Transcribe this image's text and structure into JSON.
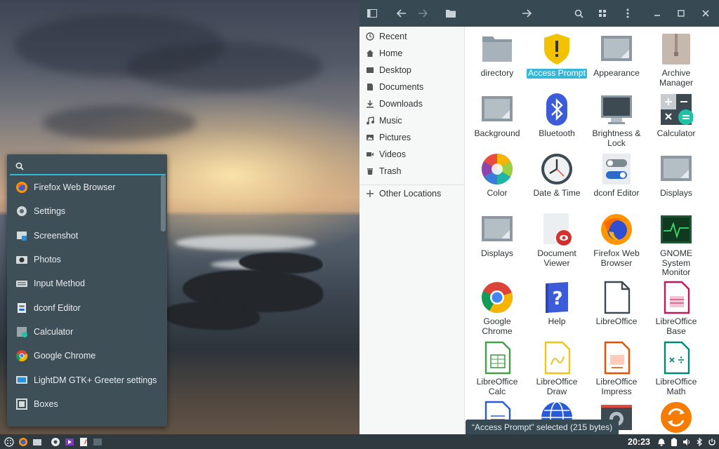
{
  "launcher": {
    "search_placeholder": "",
    "items": [
      {
        "label": "Firefox Web Browser",
        "icon": "firefox-icon"
      },
      {
        "label": "Settings",
        "icon": "settings-icon"
      },
      {
        "label": "Screenshot",
        "icon": "screenshot-icon"
      },
      {
        "label": "Photos",
        "icon": "photos-icon"
      },
      {
        "label": "Input Method",
        "icon": "keyboard-icon"
      },
      {
        "label": "dconf Editor",
        "icon": "dconf-icon"
      },
      {
        "label": "Calculator",
        "icon": "calculator-icon"
      },
      {
        "label": "Google Chrome",
        "icon": "chrome-icon"
      },
      {
        "label": "LightDM GTK+ Greeter settings",
        "icon": "lightdm-icon"
      },
      {
        "label": "Boxes",
        "icon": "boxes-icon"
      }
    ]
  },
  "taskbar": {
    "clock": "20:23"
  },
  "file_manager": {
    "sidebar": [
      {
        "label": "Recent",
        "icon": "clock-icon"
      },
      {
        "label": "Home",
        "icon": "home-icon"
      },
      {
        "label": "Desktop",
        "icon": "desktop-icon"
      },
      {
        "label": "Documents",
        "icon": "documents-icon"
      },
      {
        "label": "Downloads",
        "icon": "downloads-icon"
      },
      {
        "label": "Music",
        "icon": "music-icon"
      },
      {
        "label": "Pictures",
        "icon": "pictures-icon"
      },
      {
        "label": "Videos",
        "icon": "videos-icon"
      },
      {
        "label": "Trash",
        "icon": "trash-icon"
      }
    ],
    "other_locations": "Other Locations",
    "grid": [
      {
        "label": "directory",
        "icon": "folder-icon"
      },
      {
        "label": "Access Prompt",
        "icon": "warning-shield-icon",
        "selected": true
      },
      {
        "label": "Appearance",
        "icon": "appearance-icon"
      },
      {
        "label": "Archive Manager",
        "icon": "archive-icon"
      },
      {
        "label": "Background",
        "icon": "background-icon"
      },
      {
        "label": "Bluetooth",
        "icon": "bluetooth-icon"
      },
      {
        "label": "Brightness & Lock",
        "icon": "monitor-icon"
      },
      {
        "label": "Calculator",
        "icon": "calculator-icon"
      },
      {
        "label": "Color",
        "icon": "color-wheel-icon"
      },
      {
        "label": "Date & Time",
        "icon": "clock-icon"
      },
      {
        "label": "dconf Editor",
        "icon": "toggles-icon"
      },
      {
        "label": "Displays",
        "icon": "display-icon"
      },
      {
        "label": "Displays",
        "icon": "display-icon"
      },
      {
        "label": "Document Viewer",
        "icon": "document-viewer-icon"
      },
      {
        "label": "Firefox Web Browser",
        "icon": "firefox-icon"
      },
      {
        "label": "GNOME System Monitor",
        "icon": "system-monitor-icon"
      },
      {
        "label": "Google Chrome",
        "icon": "chrome-icon"
      },
      {
        "label": "Help",
        "icon": "help-icon"
      },
      {
        "label": "LibreOffice",
        "icon": "libreoffice-icon"
      },
      {
        "label": "LibreOffice Base",
        "icon": "libreoffice-base-icon"
      },
      {
        "label": "LibreOffice Calc",
        "icon": "libreoffice-calc-icon"
      },
      {
        "label": "LibreOffice Draw",
        "icon": "libreoffice-draw-icon"
      },
      {
        "label": "LibreOffice Impress",
        "icon": "libreoffice-impress-icon"
      },
      {
        "label": "LibreOffice Math",
        "icon": "libreoffice-math-icon"
      },
      {
        "label": "",
        "icon": "libreoffice-writer-icon"
      },
      {
        "label": "",
        "icon": "globe-icon"
      },
      {
        "label": "",
        "icon": "webcam-icon"
      },
      {
        "label": "",
        "icon": "update-icon"
      }
    ],
    "status": "“Access Prompt” selected  (215 bytes)"
  },
  "colors": {
    "accent": "#35b8d8",
    "header": "#374a54",
    "launcher_bg": "#3e4f58",
    "taskbar_bg": "#2f3a40"
  }
}
